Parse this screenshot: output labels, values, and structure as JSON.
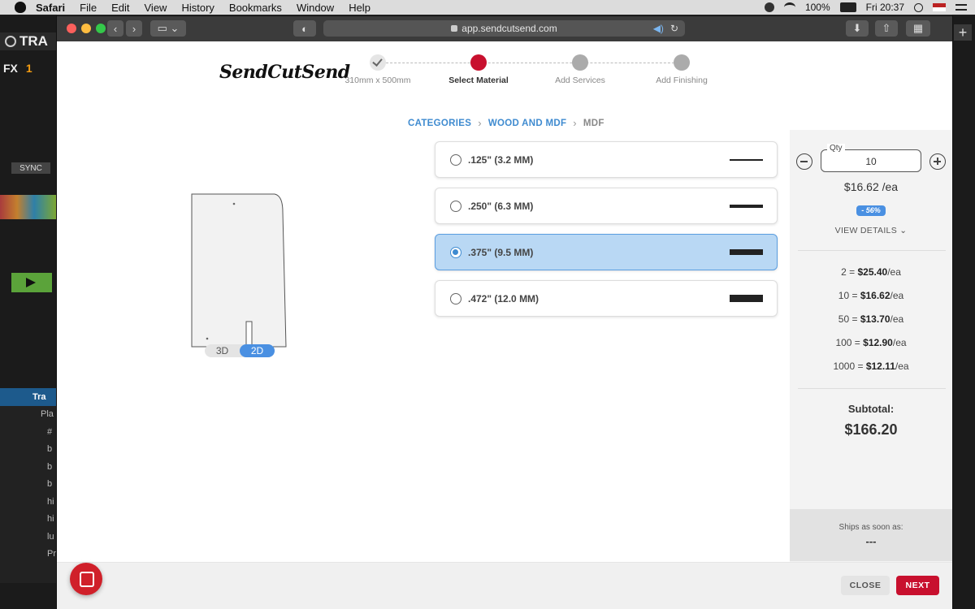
{
  "menubar": {
    "app": "Safari",
    "items": [
      "File",
      "Edit",
      "View",
      "History",
      "Bookmarks",
      "Window",
      "Help"
    ],
    "battery": "100%",
    "clock": "Fri 20:37"
  },
  "background_app": {
    "title": "TRA",
    "fx": "FX",
    "sync": "SYNC",
    "list_selected": "Tra",
    "list_items": [
      "Pla",
      "#",
      "b",
      "b",
      "b",
      "hi",
      "hi",
      "lu",
      "Pr"
    ]
  },
  "browser": {
    "url": "app.sendcutsend.com"
  },
  "brand": {
    "logo_text": "SendCutSend"
  },
  "steps": [
    {
      "label": "310mm x 500mm",
      "state": "done"
    },
    {
      "label": "Select Material",
      "state": "active"
    },
    {
      "label": "Add Services",
      "state": "pending"
    },
    {
      "label": "Add Finishing",
      "state": "pending"
    }
  ],
  "breadcrumb": {
    "items": [
      "CATEGORIES",
      "WOOD AND MDF"
    ],
    "current": "MDF"
  },
  "preview": {
    "toggle": [
      "3D",
      "2D"
    ],
    "active": "2D"
  },
  "thickness_options": [
    {
      "label": ".125\" (3.2 MM)",
      "selected": false,
      "mm": 3.2
    },
    {
      "label": ".250\" (6.3 MM)",
      "selected": false,
      "mm": 6.3
    },
    {
      "label": ".375\" (9.5 MM)",
      "selected": true,
      "mm": 9.5
    },
    {
      "label": ".472\" (12.0 MM)",
      "selected": false,
      "mm": 12.0
    }
  ],
  "pricing": {
    "qty_label": "Qty",
    "qty_value": "10",
    "price_each": "$16.62 /ea",
    "discount": "- 56%",
    "view_details": "VIEW DETAILS",
    "tiers": [
      {
        "qty": "2 =",
        "price": "$25.40",
        "unit": "/ea"
      },
      {
        "qty": "10 =",
        "price": "$16.62",
        "unit": "/ea"
      },
      {
        "qty": "50 =",
        "price": "$13.70",
        "unit": "/ea"
      },
      {
        "qty": "100 =",
        "price": "$12.90",
        "unit": "/ea"
      },
      {
        "qty": "1000 =",
        "price": "$12.11",
        "unit": "/ea"
      }
    ],
    "subtotal_label": "Subtotal:",
    "subtotal_value": "$166.20",
    "ships_label": "Ships as soon as:",
    "ships_value": "---"
  },
  "footer": {
    "close": "CLOSE",
    "next": "NEXT"
  },
  "colors": {
    "accent_red": "#c8102e",
    "accent_blue": "#3f8bd0",
    "selected_bg": "#b9d8f4"
  }
}
